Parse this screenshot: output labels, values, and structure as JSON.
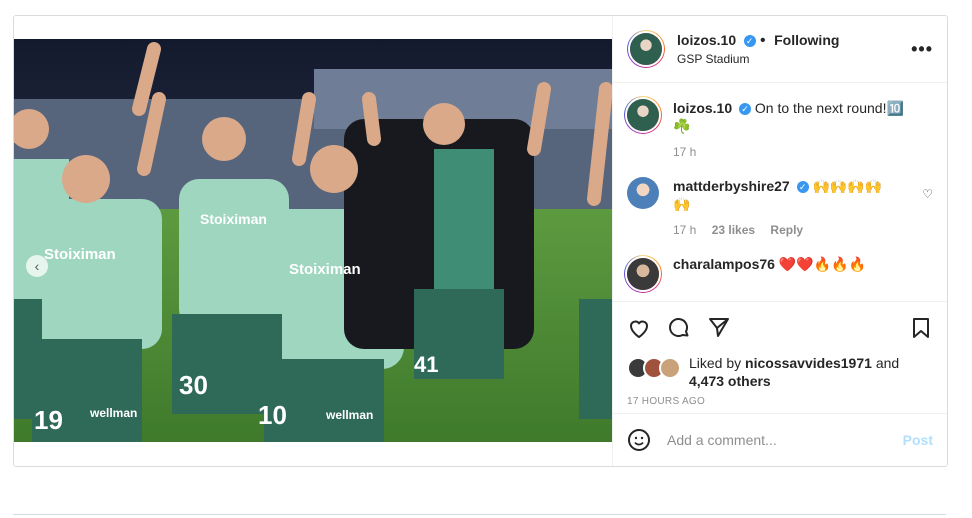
{
  "header": {
    "username": "loizos.10",
    "separator": "•",
    "follow_label": "Following",
    "location": "GSP Stadium",
    "more_label": "•••"
  },
  "caption": {
    "username": "loizos.10",
    "text": "On to the next round!🔟",
    "text2": "☘️",
    "time": "17 h"
  },
  "comments": [
    {
      "username": "mattderbyshire27",
      "text": "🙌🙌🙌🙌",
      "text2": "🙌",
      "time": "17 h",
      "likes": "23 likes",
      "reply_label": "Reply"
    },
    {
      "username": "charalampos76",
      "text": "❤️❤️🔥🔥🔥"
    }
  ],
  "photo": {
    "jersey_sponsor": "Stoiximan",
    "numbers": [
      "19",
      "30",
      "10",
      "41"
    ],
    "shorts_sponsor": "wellman",
    "colors": {
      "kit": "#9fd6c0",
      "shorts": "#2f6a58",
      "pitch": "#4f8a35",
      "sky": "#1c2238"
    }
  },
  "likes": {
    "prefix": "Liked by",
    "user": "nicossavvides1971",
    "and": "and",
    "others": "4,473 others"
  },
  "timestamp": "17 HOURS AGO",
  "add_comment": {
    "placeholder": "Add a comment...",
    "post_label": "Post"
  },
  "icons": {
    "like": "heart-icon",
    "comment": "comment-bubble-icon",
    "share": "paper-plane-icon",
    "save": "bookmark-icon",
    "emoji": "emoji-icon",
    "verified": "verified-badge-icon",
    "prev": "chevron-left-icon"
  },
  "colors": {
    "verified": "#3897f0",
    "post_button": "#b2dffc",
    "muted": "#8e8e8e",
    "border": "#dbdbdb"
  }
}
